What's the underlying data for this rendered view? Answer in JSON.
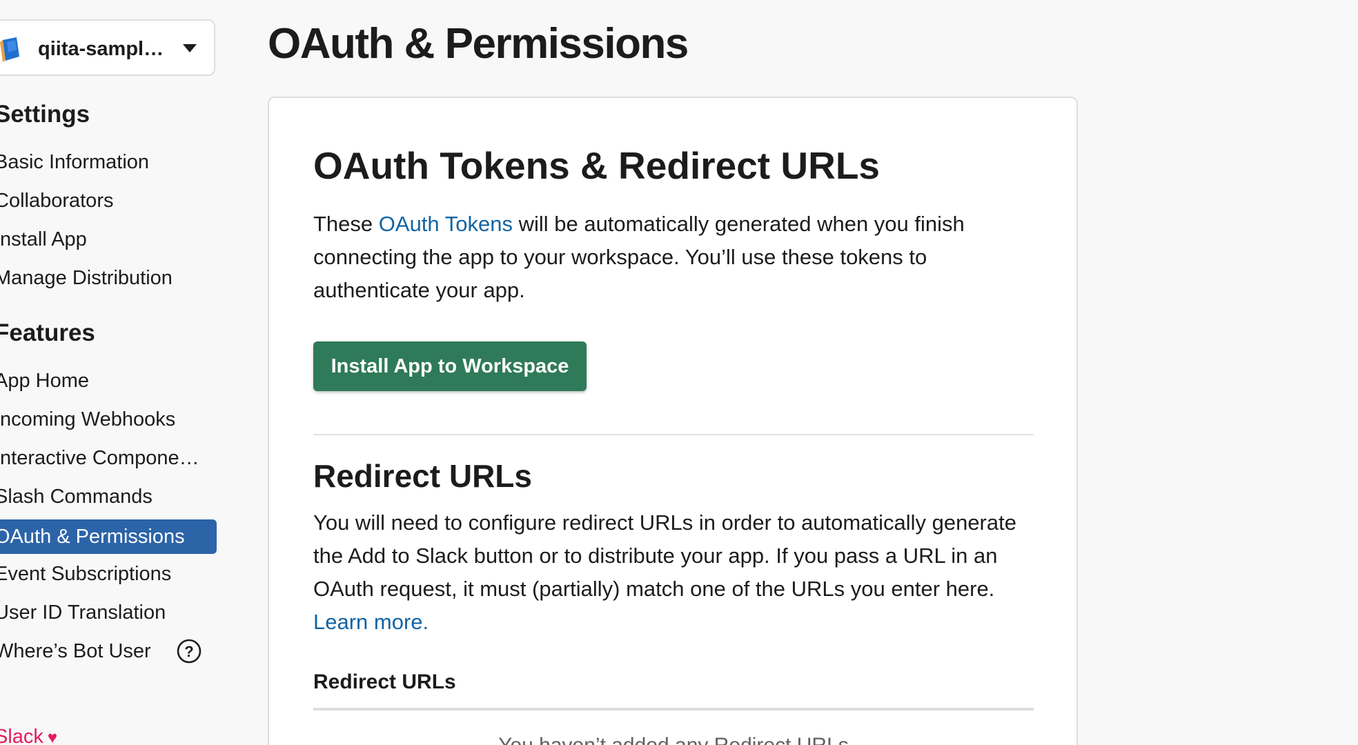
{
  "app_switcher": {
    "app_name": "qiita-sampl…"
  },
  "sidebar": {
    "settings_title": "Settings",
    "settings_items": [
      {
        "label": "Basic Information"
      },
      {
        "label": "Collaborators"
      },
      {
        "label": "Install App"
      },
      {
        "label": "Manage Distribution"
      }
    ],
    "features_title": "Features",
    "features_items": [
      {
        "label": "App Home"
      },
      {
        "label": "Incoming Webhooks"
      },
      {
        "label": "Interactive Compone…"
      },
      {
        "label": "Slash Commands"
      },
      {
        "label": "OAuth & Permissions",
        "active": true
      },
      {
        "label": "Event Subscriptions"
      },
      {
        "label": "User ID Translation"
      },
      {
        "label": "Where’s Bot User"
      }
    ],
    "footer_link": "Slack"
  },
  "main": {
    "page_title": "OAuth & Permissions",
    "tokens_section": {
      "title": "OAuth Tokens & Redirect URLs",
      "description_before": "These ",
      "description_link": "OAuth Tokens",
      "description_after": " will be automatically generated when you finish connecting the app to your workspace. You’ll use these tokens to authenticate your app.",
      "install_button": "Install App to Workspace"
    },
    "redirect_section": {
      "title": "Redirect URLs",
      "description": "You will need to configure redirect URLs in order to automatically generate the Add to Slack button or to distribute your app. If you pass a URL in an OAuth request, it must (partially) match one of the URLs you enter here. ",
      "learn_more": "Learn more.",
      "table_heading": "Redirect URLs",
      "empty_message": "You haven’t added any Redirect URLs"
    }
  },
  "colors": {
    "active_nav": "#2c64a8",
    "install_button": "#2f7a58",
    "link": "#1264a3",
    "footer_link": "#e01e5a"
  }
}
